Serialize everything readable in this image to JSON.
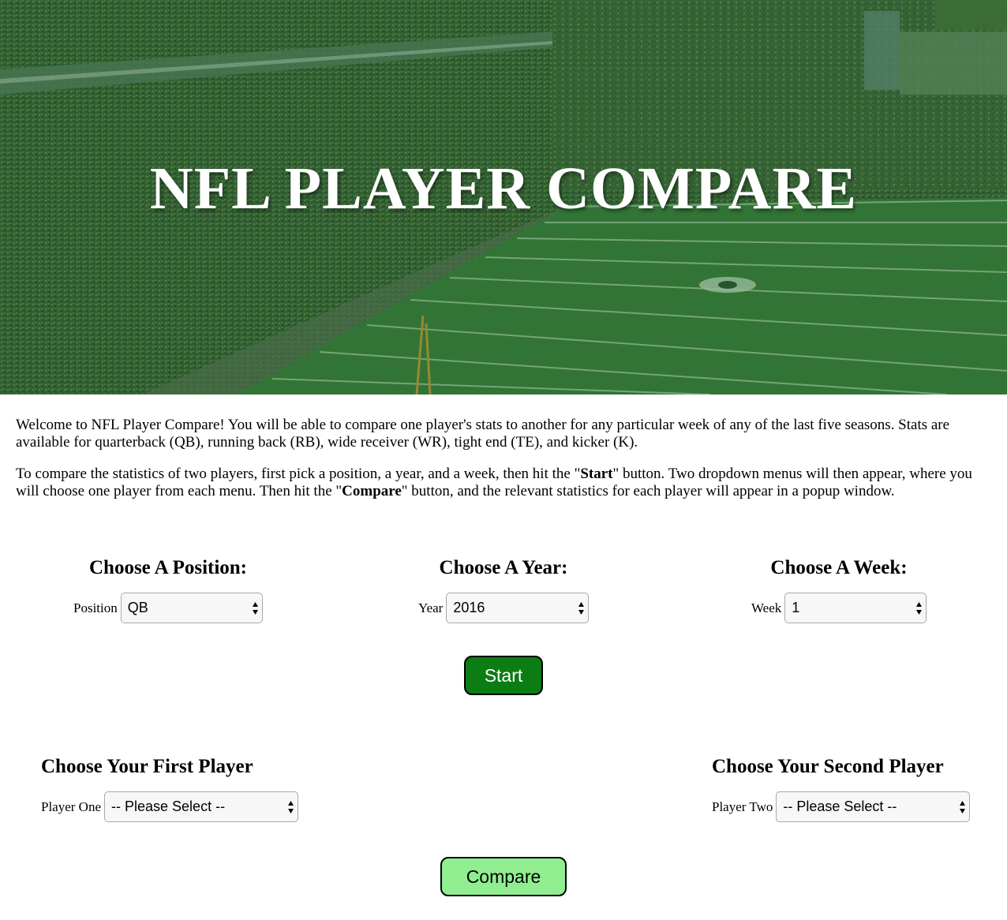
{
  "hero": {
    "title": "NFL PLAYER COMPARE",
    "background_image": "stadium-aerial-photo",
    "overlay_color": "#1f6b2e"
  },
  "intro": {
    "paragraph1": "Welcome to NFL Player Compare! You will be able to compare one player's stats to another for any particular week of any of the last five seasons. Stats are available for quarterback (QB), running back (RB), wide receiver (WR), tight end (TE), and kicker (K).",
    "p2_before_start": "To compare the statistics of two players, first pick a position, a year, and a week, then hit the \"",
    "p2_start_word": "Start",
    "p2_middle": "\" button. Two dropdown menus will then appear, where you will choose one player from each menu. Then hit the \"",
    "p2_compare_word": "Compare",
    "p2_after": "\" button, and the relevant statistics for each player will appear in a popup window."
  },
  "position": {
    "heading": "Choose A Position:",
    "label": "Position",
    "value": "QB"
  },
  "year": {
    "heading": "Choose A Year:",
    "label": "Year",
    "value": "2016"
  },
  "week": {
    "heading": "Choose A Week:",
    "label": "Week",
    "value": "1"
  },
  "start_button": {
    "label": "Start",
    "color": "#0b7d12"
  },
  "player_one": {
    "heading": "Choose Your First Player",
    "label": "Player One",
    "value": "-- Please Select --"
  },
  "player_two": {
    "heading": "Choose Your Second Player",
    "label": "Player Two",
    "value": "-- Please Select --"
  },
  "compare_button": {
    "label": "Compare",
    "color": "#90ee90"
  }
}
